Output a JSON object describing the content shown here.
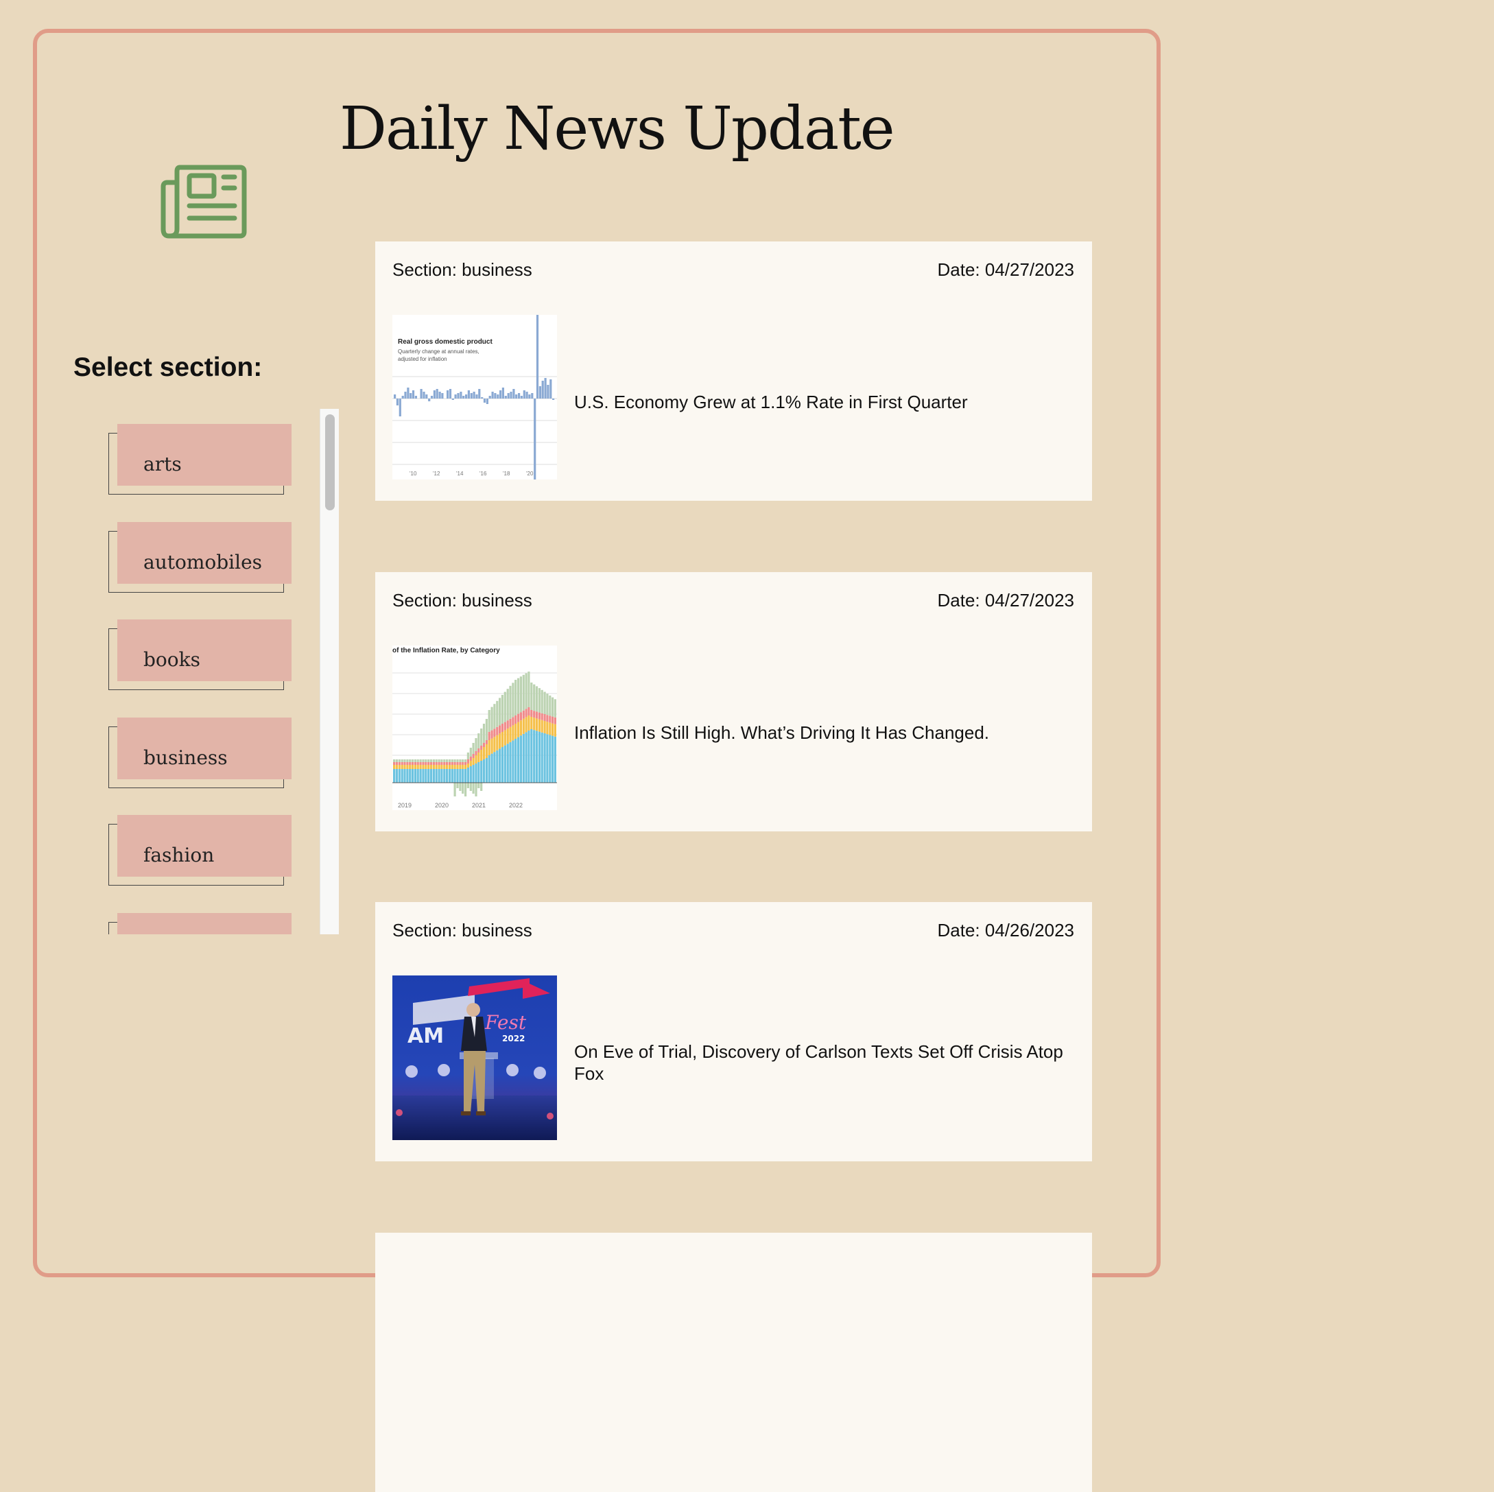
{
  "app": {
    "title": "Daily News Update",
    "logo_icon": "newspaper-icon",
    "accent_color": "#e09c88",
    "logo_color": "#6a9a5b"
  },
  "sidebar": {
    "label": "Select section:",
    "sections": [
      {
        "label": "arts"
      },
      {
        "label": "automobiles"
      },
      {
        "label": "books"
      },
      {
        "label": "business"
      },
      {
        "label": "fashion"
      },
      {
        "label": ""
      }
    ]
  },
  "articles": [
    {
      "section": "Section: business",
      "date": "Date: 04/27/2023",
      "headline": "U.S. Economy Grew at 1.1% Rate in First Quarter",
      "image": {
        "kind": "gdp-chart",
        "title": "Real gross domestic product",
        "subtitle_line1": "Quarterly change at annual rates,",
        "subtitle_line2": "adjusted for inflation",
        "x_labels": [
          "'10",
          "'12",
          "'14",
          "'16",
          "'18",
          "'20"
        ]
      }
    },
    {
      "section": "Section: business",
      "date": "Date: 04/27/2023",
      "headline": "Inflation Is Still High. What’s Driving It Has Changed.",
      "image": {
        "kind": "inflation-chart",
        "title": "of the Inflation Rate, by Category",
        "x_labels": [
          "2019",
          "2020",
          "2021",
          "2022"
        ]
      }
    },
    {
      "section": "Section: business",
      "date": "Date: 04/26/2023",
      "headline": "On Eve of Trial, Discovery of Carlson Texts Set Off Crisis Atop Fox",
      "image": {
        "kind": "photo",
        "subject": "speaker at podium on stage"
      }
    },
    {
      "section": "",
      "date": "",
      "headline": "",
      "image": null
    }
  ]
}
